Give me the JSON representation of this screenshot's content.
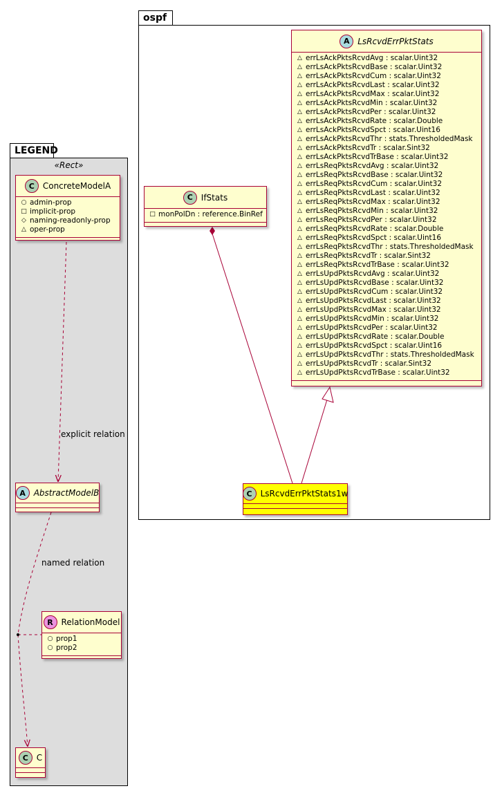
{
  "packages": {
    "legend": {
      "name": "LEGEND",
      "stereotype": "«Rect»"
    },
    "ospf": {
      "name": "ospf"
    }
  },
  "classes": {
    "concrete_model_a": {
      "name": "ConcreteModelA",
      "kind": "C",
      "attrs": [
        {
          "vis": "+",
          "text": "admin-prop"
        },
        {
          "vis": "-",
          "text": "implicit-prop"
        },
        {
          "vis": "#",
          "text": "naming-readonly-prop"
        },
        {
          "vis": "~",
          "text": "oper-prop"
        }
      ]
    },
    "abstract_model_b": {
      "name": "AbstractModelB",
      "kind": "A"
    },
    "relation_model": {
      "name": "RelationModel",
      "kind": "R",
      "attrs": [
        {
          "vis": "+",
          "text": "prop1"
        },
        {
          "vis": "+",
          "text": "prop2"
        }
      ]
    },
    "c": {
      "name": "C",
      "kind": "C"
    },
    "if_stats": {
      "name": "IfStats",
      "kind": "C",
      "attrs": [
        {
          "vis": "-",
          "text": "monPolDn : reference.BinRef"
        }
      ]
    },
    "ls_rcvd_err_pkt_stats": {
      "name": "LsRcvdErrPktStats",
      "kind": "A",
      "attrs": [
        {
          "vis": "~",
          "text": "errLsAckPktsRcvdAvg : scalar.Uint32"
        },
        {
          "vis": "~",
          "text": "errLsAckPktsRcvdBase : scalar.Uint32"
        },
        {
          "vis": "~",
          "text": "errLsAckPktsRcvdCum : scalar.Uint32"
        },
        {
          "vis": "~",
          "text": "errLsAckPktsRcvdLast : scalar.Uint32"
        },
        {
          "vis": "~",
          "text": "errLsAckPktsRcvdMax : scalar.Uint32"
        },
        {
          "vis": "~",
          "text": "errLsAckPktsRcvdMin : scalar.Uint32"
        },
        {
          "vis": "~",
          "text": "errLsAckPktsRcvdPer : scalar.Uint32"
        },
        {
          "vis": "~",
          "text": "errLsAckPktsRcvdRate : scalar.Double"
        },
        {
          "vis": "~",
          "text": "errLsAckPktsRcvdSpct : scalar.Uint16"
        },
        {
          "vis": "~",
          "text": "errLsAckPktsRcvdThr : stats.ThresholdedMask"
        },
        {
          "vis": "~",
          "text": "errLsAckPktsRcvdTr : scalar.Sint32"
        },
        {
          "vis": "~",
          "text": "errLsAckPktsRcvdTrBase : scalar.Uint32"
        },
        {
          "vis": "~",
          "text": "errLsReqPktsRcvdAvg : scalar.Uint32"
        },
        {
          "vis": "~",
          "text": "errLsReqPktsRcvdBase : scalar.Uint32"
        },
        {
          "vis": "~",
          "text": "errLsReqPktsRcvdCum : scalar.Uint32"
        },
        {
          "vis": "~",
          "text": "errLsReqPktsRcvdLast : scalar.Uint32"
        },
        {
          "vis": "~",
          "text": "errLsReqPktsRcvdMax : scalar.Uint32"
        },
        {
          "vis": "~",
          "text": "errLsReqPktsRcvdMin : scalar.Uint32"
        },
        {
          "vis": "~",
          "text": "errLsReqPktsRcvdPer : scalar.Uint32"
        },
        {
          "vis": "~",
          "text": "errLsReqPktsRcvdRate : scalar.Double"
        },
        {
          "vis": "~",
          "text": "errLsReqPktsRcvdSpct : scalar.Uint16"
        },
        {
          "vis": "~",
          "text": "errLsReqPktsRcvdThr : stats.ThresholdedMask"
        },
        {
          "vis": "~",
          "text": "errLsReqPktsRcvdTr : scalar.Sint32"
        },
        {
          "vis": "~",
          "text": "errLsReqPktsRcvdTrBase : scalar.Uint32"
        },
        {
          "vis": "~",
          "text": "errLsUpdPktsRcvdAvg : scalar.Uint32"
        },
        {
          "vis": "~",
          "text": "errLsUpdPktsRcvdBase : scalar.Uint32"
        },
        {
          "vis": "~",
          "text": "errLsUpdPktsRcvdCum : scalar.Uint32"
        },
        {
          "vis": "~",
          "text": "errLsUpdPktsRcvdLast : scalar.Uint32"
        },
        {
          "vis": "~",
          "text": "errLsUpdPktsRcvdMax : scalar.Uint32"
        },
        {
          "vis": "~",
          "text": "errLsUpdPktsRcvdMin : scalar.Uint32"
        },
        {
          "vis": "~",
          "text": "errLsUpdPktsRcvdPer : scalar.Uint32"
        },
        {
          "vis": "~",
          "text": "errLsUpdPktsRcvdRate : scalar.Double"
        },
        {
          "vis": "~",
          "text": "errLsUpdPktsRcvdSpct : scalar.Uint16"
        },
        {
          "vis": "~",
          "text": "errLsUpdPktsRcvdThr : stats.ThresholdedMask"
        },
        {
          "vis": "~",
          "text": "errLsUpdPktsRcvdTr : scalar.Sint32"
        },
        {
          "vis": "~",
          "text": "errLsUpdPktsRcvdTrBase : scalar.Uint32"
        }
      ]
    },
    "ls_rcvd_err_pkt_stats_1w": {
      "name": "LsRcvdErrPktStats1w",
      "kind": "C"
    }
  },
  "relations": {
    "explicit": "explicit relation",
    "named": "named relation"
  },
  "colors": {
    "class_fill": "#FEFECE",
    "class_border": "#A80036",
    "highlight_fill": "#FFFF00",
    "legend_fill": "#DDDDDD",
    "circle_class": "#ADD1B2",
    "circle_abstract": "#A9DCDF",
    "circle_relation": "#EB93DF",
    "line": "#A80036"
  },
  "icons": {
    "class": "circle-c-icon",
    "abstract": "circle-a-icon",
    "relation": "circle-r-icon",
    "public": "open-circle-icon",
    "private": "open-square-icon",
    "protected": "open-diamond-icon",
    "package": "open-triangle-icon"
  }
}
